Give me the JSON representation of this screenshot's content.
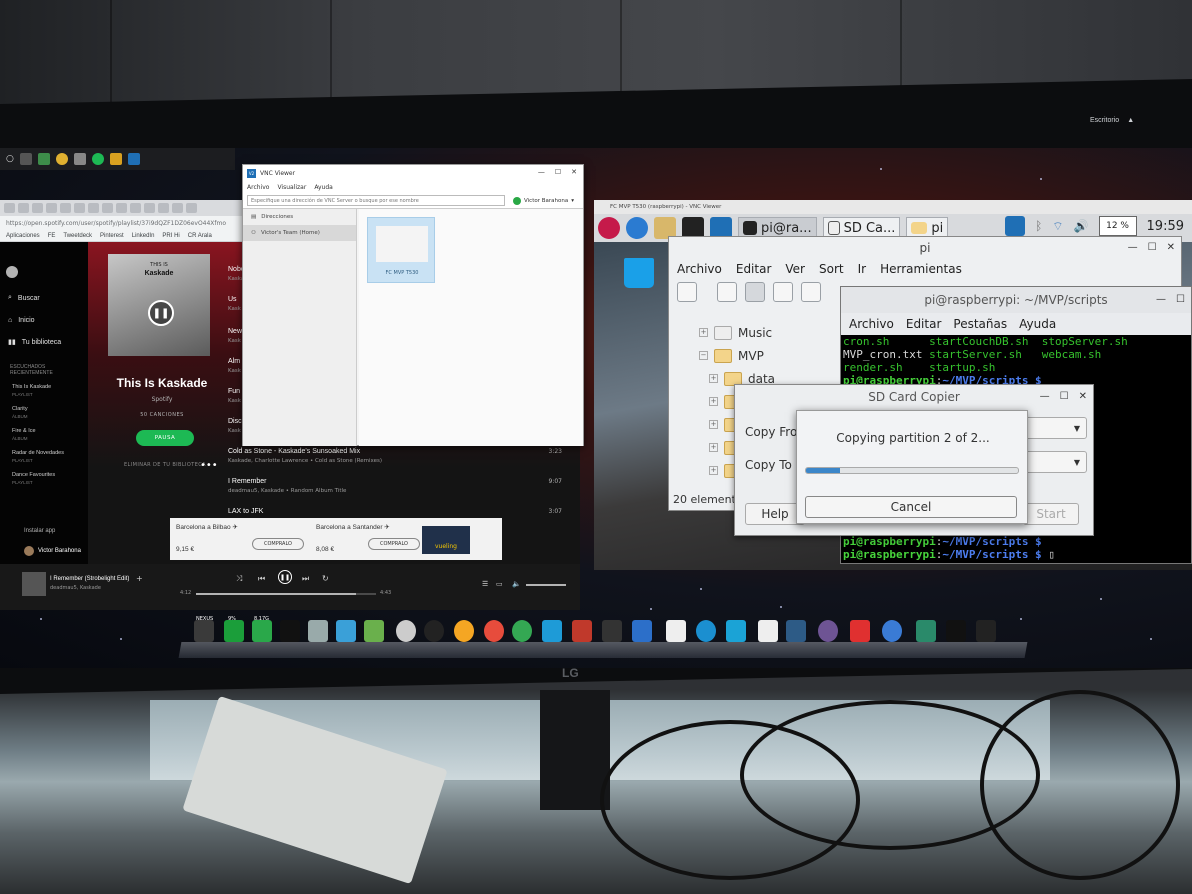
{
  "windows_taskbar": {
    "sys_label": "Escritorio"
  },
  "chrome": {
    "url": "https://open.spotify.com/user/spotify/playlist/37i9dQZF1DZ06evO44Xfmo",
    "bookmarks": [
      "Aplicaciones",
      "FE",
      "Tweetdeck",
      "Pinterest",
      "LinkedIn",
      "PRI Hi",
      "CR Arala"
    ]
  },
  "spotify": {
    "nav": {
      "search": "Buscar",
      "home": "Inicio",
      "library": "Tu biblioteca"
    },
    "recent_header": "ESCUCHADOS RECIENTEMENTE",
    "recent": [
      {
        "name": "This Is Kaskade",
        "type": "PLAYLIST"
      },
      {
        "name": "Clarity",
        "type": "ÁLBUM"
      },
      {
        "name": "Fire & Ice",
        "type": "ÁLBUM"
      },
      {
        "name": "Radar de Novedades",
        "type": "PLAYLIST"
      },
      {
        "name": "Dance Favourites",
        "type": "PLAYLIST"
      }
    ],
    "install_app": "Instalar app",
    "user_name": "Victor Barahona",
    "playlist": {
      "cover_top": "THIS IS",
      "cover_name": "Kaskade",
      "title": "This Is Kaskade",
      "owner": "Spotify",
      "count": "50 CANCIONES",
      "pause_button": "PAUSA",
      "remove_text": "ELIMINAR DE TU BIBLIOTECA",
      "more": "•••"
    },
    "tracks": [
      {
        "name": "Nobo",
        "meta": "Kaska",
        "duration": ""
      },
      {
        "name": "Us",
        "meta": "Kask",
        "duration": ""
      },
      {
        "name": "New",
        "meta": "Kask",
        "duration": ""
      },
      {
        "name": "Alm",
        "meta": "Kask",
        "duration": ""
      },
      {
        "name": "Fun",
        "meta": "Kask",
        "duration": ""
      },
      {
        "name": "Disc",
        "meta": "Kask",
        "duration": ""
      },
      {
        "name": "Cold as Stone - Kaskade's Sunsoaked Mix",
        "meta": "Kaskade, Charlotte Lawrence  •  Cold as Stone (Remixes)",
        "duration": "3:23"
      },
      {
        "name": "I Remember",
        "meta": "deadmau5, Kaskade  •  Random Album Title",
        "duration": "9:07"
      },
      {
        "name": "LAX to JFK",
        "meta": "",
        "duration": "3:07"
      }
    ],
    "ad": {
      "route1": "Barcelona a Bilbao ✈",
      "price1": "9,15 €",
      "route2": "Barcelona a Santander ✈",
      "price2": "8,08 €",
      "cta1": "COMPRALO",
      "cta2": "COMPRALO",
      "brand": "vueling"
    },
    "player": {
      "title": "I Remember (Strobelight Edit)",
      "artist": "deadmau5, Kaskade",
      "elapsed": "4:12",
      "total": "4:43",
      "progress": 0.89
    }
  },
  "vnc_viewer": {
    "title": "VNC Viewer",
    "menu": [
      "Archivo",
      "Visualizar",
      "Ayuda"
    ],
    "address_placeholder": "Especifique una dirección de VNC Server o busque por ese nombre",
    "user": "Victor Barahona",
    "sidebar": [
      "Direcciones",
      "Victor's Team (Home)"
    ],
    "computer_label": "FC MVP T530"
  },
  "rpi": {
    "window_title": "FC MVP T530 (raspberrypi) - VNC Viewer",
    "tasks": [
      "pi@ra...",
      "SD Ca...",
      "pi"
    ],
    "cpu": "12 %",
    "clock": "19:59",
    "file_manager": {
      "title": "pi",
      "menu": [
        "Archivo",
        "Editar",
        "Ver",
        "Sort",
        "Ir",
        "Herramientas"
      ],
      "tree": [
        {
          "name": "Music",
          "expander": "+"
        },
        {
          "name": "MVP",
          "expander": "−"
        },
        {
          "name": "data",
          "expander": "+"
        }
      ],
      "status": "20 elemento"
    },
    "terminal": {
      "title": "pi@raspberrypi: ~/MVP/scripts",
      "menu": [
        "Archivo",
        "Editar",
        "Pestañas",
        "Ayuda"
      ],
      "files_row1": [
        "cron.sh",
        "startCouchDB.sh",
        "stopServer.sh"
      ],
      "files_row2": [
        "MVP_cron.txt",
        "startServer.sh",
        "webcam.sh"
      ],
      "files_row3": [
        "render.sh",
        "startup.sh"
      ],
      "prompt_user": "pi@raspberrypi",
      "prompt_path": "~/MVP/scripts $"
    },
    "sd_copier": {
      "title": "SD Card Copier",
      "copy_from": "Copy Fro",
      "copy_to": "Copy To I",
      "help": "Help",
      "start": "Start"
    },
    "progress": {
      "message": "Copying partition 2 of 2...",
      "fraction": 0.16,
      "cancel": "Cancel"
    }
  },
  "dock": {
    "labels": [
      "NEXUS",
      "9%",
      "8,17G"
    ]
  },
  "monitor": {
    "brand": "LG"
  },
  "colors": {
    "spotify_green": "#1db954",
    "playlist_red": "#8a1520",
    "terminal_green": "#47d43c",
    "terminal_blue": "#4d7ef0",
    "progress_blue": "#3c86c9",
    "vnc_blue": "#1f6fb5"
  }
}
